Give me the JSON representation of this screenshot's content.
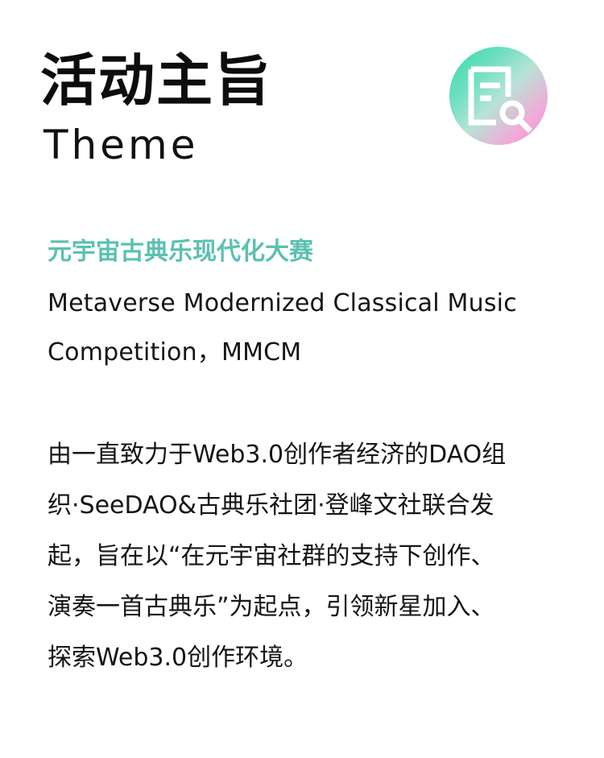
{
  "header": {
    "title_cn": "活动主旨",
    "title_en": "Theme",
    "logo_icon": "document-search-icon",
    "logo_gradient": [
      "#36d9a4",
      "#b7e3d6",
      "#e98fd3"
    ]
  },
  "competition": {
    "name_cn": "元宇宙古典乐现代化大赛",
    "name_en_line1": "Metaverse Modernized Classical Music",
    "name_en_line2": "Competition，MMCM",
    "accent_color": "#5bc1b0"
  },
  "description": {
    "lines": [
      "由一直致力于Web3.0创作者经济的DAO组",
      "织·SeeDAO&古典乐社团·登峰文社联合发",
      "起，旨在以“在元宇宙社群的支持下创作、",
      "演奏一首古典乐”为起点，引领新星加入、",
      "探索Web3.0创作环境。"
    ]
  }
}
